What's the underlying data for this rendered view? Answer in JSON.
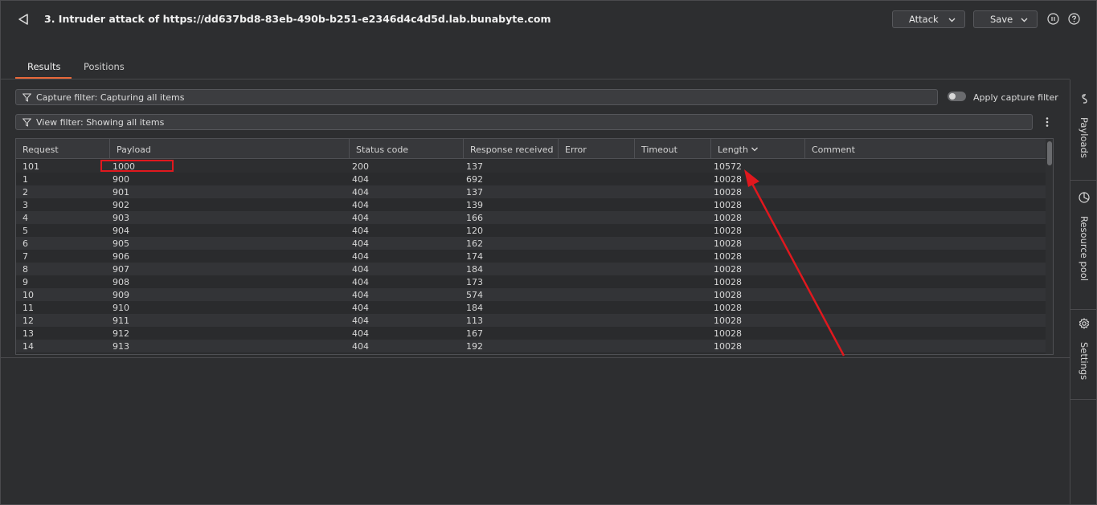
{
  "header": {
    "title": "3. Intruder attack of https://dd637bd8-83eb-490b-b251-e2346d4c4d5d.lab.bunabyte.com",
    "attack_label": "Attack",
    "save_label": "Save"
  },
  "tabs": [
    {
      "label": "Results",
      "active": true
    },
    {
      "label": "Positions",
      "active": false
    }
  ],
  "filters": {
    "capture_filter": "Capture filter: Capturing all items",
    "apply_capture_filter_label": "Apply capture filter",
    "apply_capture_filter_on": false,
    "view_filter": "View filter: Showing all items"
  },
  "sidebar": {
    "items": [
      {
        "label": "Payloads",
        "icon": "payloads-icon"
      },
      {
        "label": "Resource pool",
        "icon": "resource-pool-icon"
      },
      {
        "label": "Settings",
        "icon": "gear-icon"
      }
    ]
  },
  "table": {
    "columns": [
      "Request",
      "Payload",
      "Status code",
      "Response received",
      "Error",
      "Timeout",
      "Length",
      "Comment"
    ],
    "sort_column": "Length",
    "rows": [
      {
        "request": "101",
        "payload": "1000",
        "status": "200",
        "response": "137",
        "error": "",
        "timeout": "",
        "length": "10572",
        "comment": ""
      },
      {
        "request": "1",
        "payload": "900",
        "status": "404",
        "response": "692",
        "error": "",
        "timeout": "",
        "length": "10028",
        "comment": ""
      },
      {
        "request": "2",
        "payload": "901",
        "status": "404",
        "response": "137",
        "error": "",
        "timeout": "",
        "length": "10028",
        "comment": ""
      },
      {
        "request": "3",
        "payload": "902",
        "status": "404",
        "response": "139",
        "error": "",
        "timeout": "",
        "length": "10028",
        "comment": ""
      },
      {
        "request": "4",
        "payload": "903",
        "status": "404",
        "response": "166",
        "error": "",
        "timeout": "",
        "length": "10028",
        "comment": ""
      },
      {
        "request": "5",
        "payload": "904",
        "status": "404",
        "response": "120",
        "error": "",
        "timeout": "",
        "length": "10028",
        "comment": ""
      },
      {
        "request": "6",
        "payload": "905",
        "status": "404",
        "response": "162",
        "error": "",
        "timeout": "",
        "length": "10028",
        "comment": ""
      },
      {
        "request": "7",
        "payload": "906",
        "status": "404",
        "response": "174",
        "error": "",
        "timeout": "",
        "length": "10028",
        "comment": ""
      },
      {
        "request": "8",
        "payload": "907",
        "status": "404",
        "response": "184",
        "error": "",
        "timeout": "",
        "length": "10028",
        "comment": ""
      },
      {
        "request": "9",
        "payload": "908",
        "status": "404",
        "response": "173",
        "error": "",
        "timeout": "",
        "length": "10028",
        "comment": ""
      },
      {
        "request": "10",
        "payload": "909",
        "status": "404",
        "response": "574",
        "error": "",
        "timeout": "",
        "length": "10028",
        "comment": ""
      },
      {
        "request": "11",
        "payload": "910",
        "status": "404",
        "response": "184",
        "error": "",
        "timeout": "",
        "length": "10028",
        "comment": ""
      },
      {
        "request": "12",
        "payload": "911",
        "status": "404",
        "response": "113",
        "error": "",
        "timeout": "",
        "length": "10028",
        "comment": ""
      },
      {
        "request": "13",
        "payload": "912",
        "status": "404",
        "response": "167",
        "error": "",
        "timeout": "",
        "length": "10028",
        "comment": ""
      },
      {
        "request": "14",
        "payload": "913",
        "status": "404",
        "response": "192",
        "error": "",
        "timeout": "",
        "length": "10028",
        "comment": ""
      }
    ]
  },
  "colors": {
    "accent": "#e8683a",
    "annotation": "#e0181e",
    "background": "#2d2e30"
  }
}
